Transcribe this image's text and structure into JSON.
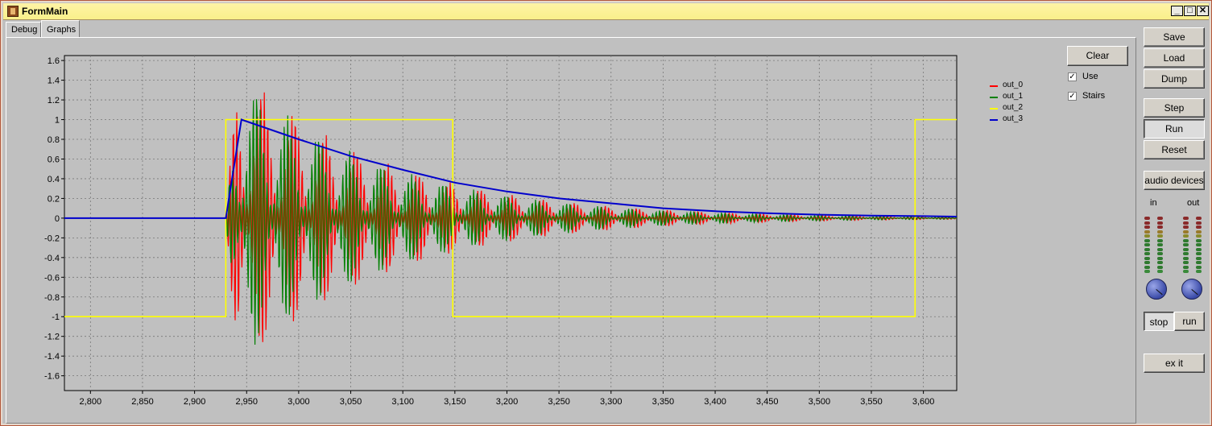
{
  "window": {
    "title": "FormMain",
    "controls": [
      "_",
      "□",
      "✕"
    ]
  },
  "tabs": [
    {
      "label": "Debug"
    },
    {
      "label": "Graphs"
    }
  ],
  "chart_data": {
    "type": "line",
    "title": "",
    "xlabel": "",
    "ylabel": "",
    "xlim": [
      2775,
      3632
    ],
    "ylim": [
      -1.75,
      1.65
    ],
    "xticks": [
      2800,
      2850,
      2900,
      2950,
      3000,
      3050,
      3100,
      3150,
      3200,
      3250,
      3300,
      3350,
      3400,
      3450,
      3500,
      3550,
      3600
    ],
    "xtick_labels": [
      "2,800",
      "2,850",
      "2,900",
      "2,950",
      "3,000",
      "3,050",
      "3,100",
      "3,150",
      "3,200",
      "3,250",
      "3,300",
      "3,350",
      "3,400",
      "3,450",
      "3,500",
      "3,550",
      "3,600"
    ],
    "yticks": [
      1.6,
      1.4,
      1.2,
      1,
      0.8,
      0.6,
      0.4,
      0.2,
      0,
      -0.2,
      -0.4,
      -0.6,
      -0.8,
      -1,
      -1.2,
      -1.4,
      -1.6
    ],
    "ytick_labels": [
      "1.6",
      "1.4",
      "1.2",
      "1",
      "0.8",
      "0.6",
      "0.4",
      "0.2",
      "0",
      "-0.2",
      "-0.4",
      "-0.6",
      "-0.8",
      "-1",
      "-1.2",
      "-1.4",
      "-1.6"
    ],
    "grid": true,
    "legend_position": "right",
    "series": [
      {
        "name": "out_0",
        "color": "#ff0000",
        "description": "decaying oscillation starting at 2930, peak ±1.7",
        "start": 2930,
        "amplitude": 1.7,
        "decay": 140
      },
      {
        "name": "out_1",
        "color": "#008000",
        "description": "decaying oscillation starting at 2930",
        "start": 2930,
        "amplitude": 1.6,
        "decay": 140
      },
      {
        "name": "out_2",
        "color": "#ffff00",
        "points": [
          [
            2775,
            -1
          ],
          [
            2930,
            -1
          ],
          [
            2930,
            1
          ],
          [
            3148,
            1
          ],
          [
            3148,
            -1
          ],
          [
            3592,
            -1
          ],
          [
            3592,
            1
          ],
          [
            3632,
            1
          ]
        ]
      },
      {
        "name": "out_3",
        "color": "#0000cc",
        "points": [
          [
            2775,
            0
          ],
          [
            2930,
            0
          ],
          [
            2945,
            1
          ],
          [
            3000,
            0.8
          ],
          [
            3050,
            0.63
          ],
          [
            3100,
            0.49
          ],
          [
            3150,
            0.36
          ],
          [
            3200,
            0.27
          ],
          [
            3250,
            0.2
          ],
          [
            3300,
            0.15
          ],
          [
            3350,
            0.1
          ],
          [
            3400,
            0.07
          ],
          [
            3450,
            0.05
          ],
          [
            3500,
            0.035
          ],
          [
            3550,
            0.025
          ],
          [
            3600,
            0.02
          ],
          [
            3632,
            0.015
          ]
        ]
      }
    ]
  },
  "controls": {
    "clear": "Clear",
    "use": {
      "label": "Use",
      "checked": true
    },
    "stairs": {
      "label": "Stairs",
      "checked": true
    }
  },
  "side": {
    "save": "Save",
    "load": "Load",
    "dump": "Dump",
    "step": "Step",
    "run": "Run",
    "reset": "Reset",
    "audio_devices": "audio devices",
    "in_label": "in",
    "out_label": "out",
    "stop": "stop",
    "run_small": "run",
    "exit": "ex it"
  }
}
